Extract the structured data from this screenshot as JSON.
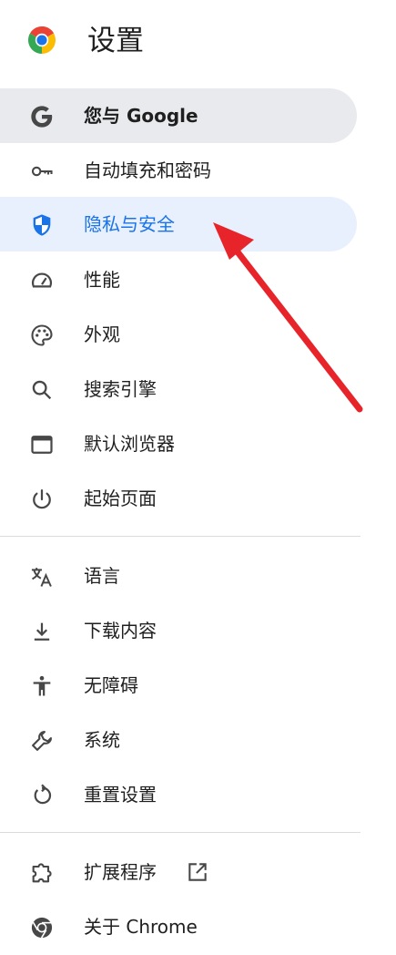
{
  "header": {
    "title": "设置",
    "logo": "chrome-logo-icon"
  },
  "nav": {
    "items": [
      {
        "label": "您与 Google",
        "icon": "google-g-icon"
      },
      {
        "label": "自动填充和密码",
        "icon": "key-icon"
      },
      {
        "label": "隐私与安全",
        "icon": "shield-icon"
      },
      {
        "label": "性能",
        "icon": "speedometer-icon"
      },
      {
        "label": "外观",
        "icon": "palette-icon"
      },
      {
        "label": "搜索引擎",
        "icon": "search-icon"
      },
      {
        "label": "默认浏览器",
        "icon": "browser-window-icon"
      },
      {
        "label": "起始页面",
        "icon": "power-icon"
      },
      {
        "label": "语言",
        "icon": "translate-icon"
      },
      {
        "label": "下载内容",
        "icon": "download-icon"
      },
      {
        "label": "无障碍",
        "icon": "accessibility-icon"
      },
      {
        "label": "系统",
        "icon": "wrench-icon"
      },
      {
        "label": "重置设置",
        "icon": "reset-icon"
      },
      {
        "label": "扩展程序",
        "icon": "puzzle-icon",
        "trailing_icon": "open-in-new-icon"
      },
      {
        "label": "关于 Chrome",
        "icon": "chrome-icon"
      }
    ],
    "hovered": "您与 Google",
    "selected": "隐私与安全"
  },
  "colors": {
    "selected_text": "#1a73e8",
    "selected_bg": "#e8f0fe",
    "hover_bg": "#e8eaed",
    "icon": "#474747",
    "annotation_arrow": "#e8242b"
  }
}
